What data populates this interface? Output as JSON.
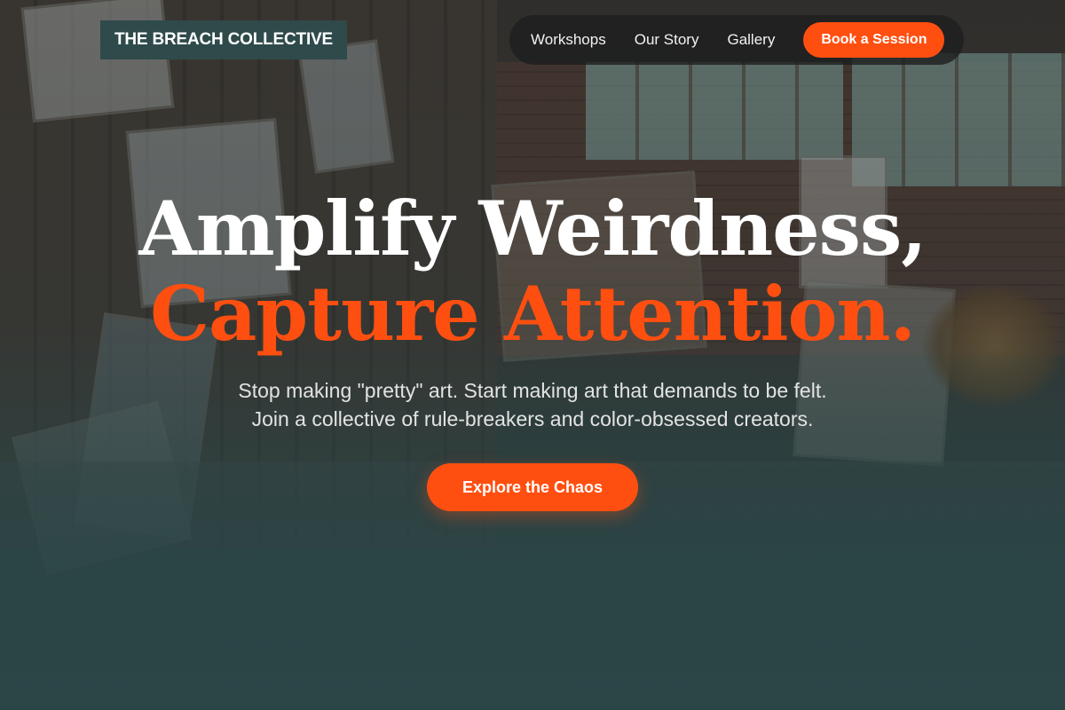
{
  "brand": {
    "name": "THE BREACH COLLECTIVE"
  },
  "nav": {
    "links": [
      {
        "label": "Workshops"
      },
      {
        "label": "Our Story"
      },
      {
        "label": "Gallery"
      }
    ],
    "cta_label": "Book a Session"
  },
  "hero": {
    "headline_line1": "Amplify Weirdness,",
    "headline_line2": "Capture Attention.",
    "subtitle": "Stop making \"pretty\" art. Start making art that demands to be felt. Join a collective of rule-breakers and color-obsessed creators.",
    "cta_label": "Explore the Chaos"
  },
  "colors": {
    "accent": "#ff4f10",
    "brand_bg": "#2f4a4b",
    "page_bottom": "#2c4648"
  }
}
